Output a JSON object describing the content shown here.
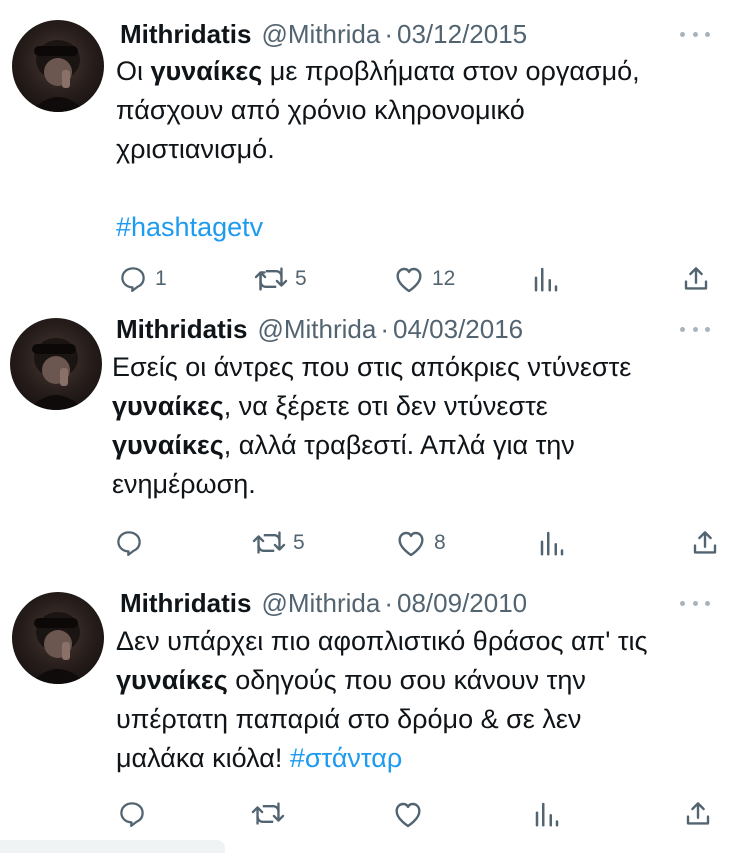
{
  "tweets": [
    {
      "name": "Mithridatis",
      "handle": "@Mithrida",
      "dot": "·",
      "date": "03/12/2015",
      "text_lines": [
        [
          {
            "t": "Οι "
          },
          {
            "t": "γυναίκες",
            "b": true
          },
          {
            "t": " με προβλήματα στον οργασμό,"
          }
        ],
        [
          {
            "t": "πάσχουν από χρόνιο κληρονομικό"
          }
        ],
        [
          {
            "t": "χριστιανισμό."
          }
        ],
        [
          {
            "t": ""
          }
        ],
        [
          {
            "t": "#hashtagetv",
            "link": true
          }
        ]
      ],
      "stats": {
        "reply": "1",
        "retweet": "5",
        "like": "12"
      }
    },
    {
      "name": "Mithridatis",
      "handle": "@Mithrida",
      "dot": "·",
      "date": "04/03/2016",
      "text_lines": [
        [
          {
            "t": "Εσείς οι άντρες που στις απόκριες ντύνεστε"
          }
        ],
        [
          {
            "t": "γυναίκες",
            "b": true
          },
          {
            "t": ", να ξέρετε οτι δεν ντύνεστε"
          }
        ],
        [
          {
            "t": "γυναίκες",
            "b": true
          },
          {
            "t": ", αλλά τραβεστί. Απλά για την"
          }
        ],
        [
          {
            "t": "ενημέρωση."
          }
        ]
      ],
      "stats": {
        "reply": "",
        "retweet": "5",
        "like": "8"
      }
    },
    {
      "name": "Mithridatis",
      "handle": "@Mithrida",
      "dot": "·",
      "date": "08/09/2010",
      "text_lines": [
        [
          {
            "t": "Δεν υπάρχει πιο αφοπλιστικό θράσος απ' τις"
          }
        ],
        [
          {
            "t": "γυναίκες",
            "b": true
          },
          {
            "t": " οδηγούς που σου κάνουν την"
          }
        ],
        [
          {
            "t": "υπέρτατη παπαριά στο δρόμο & σε λεν"
          }
        ],
        [
          {
            "t": "μαλάκα κιόλα! "
          },
          {
            "t": "#στάνταρ",
            "link": true
          }
        ]
      ],
      "stats": {
        "reply": "",
        "retweet": "",
        "like": ""
      }
    }
  ],
  "icons": {
    "reply": "reply-icon",
    "retweet": "retweet-icon",
    "like": "heart-icon",
    "views": "views-icon",
    "share": "share-icon",
    "more": "more-icon"
  },
  "colors": {
    "text": "#0f1419",
    "secondary": "#536471",
    "link": "#1d9bf0"
  }
}
